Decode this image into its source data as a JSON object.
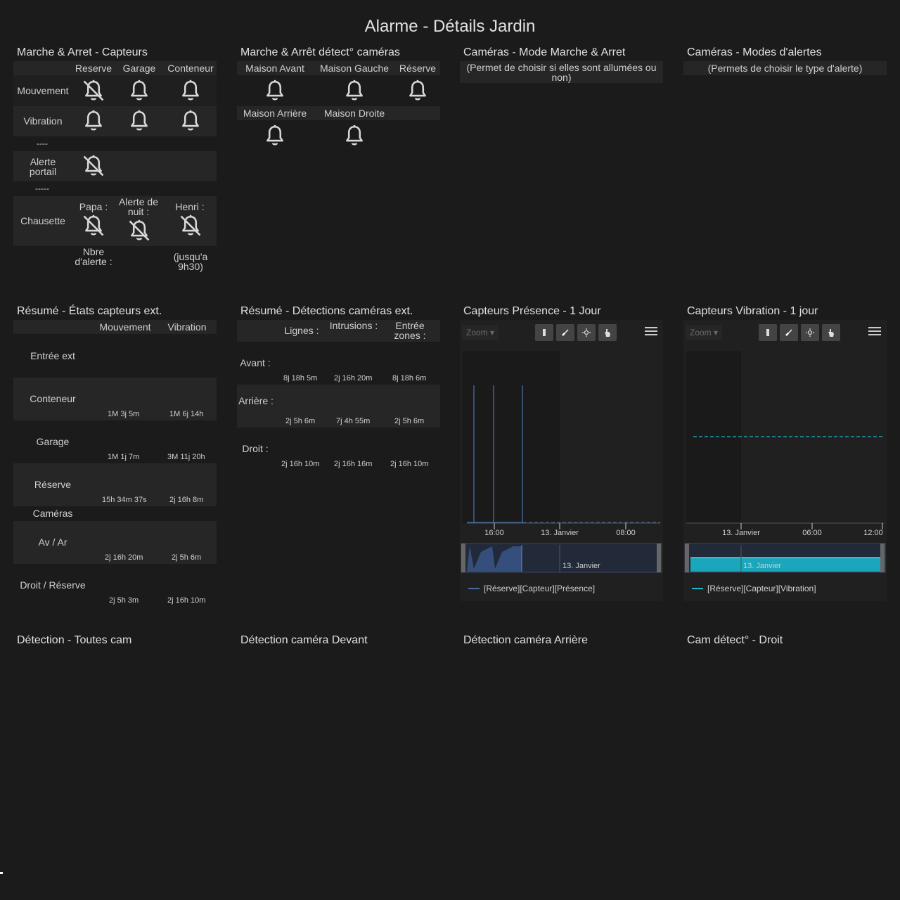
{
  "page_title": "Alarme - Détails Jardin",
  "icons": [
    "bell-icon",
    "bell-off-icon",
    "reset-zoom-icon",
    "zoom-out-icon",
    "refresh-icon",
    "pan-icon",
    "menu-icon"
  ],
  "sensors": {
    "title": "Marche & Arret - Capteurs",
    "headers": [
      "Reserve",
      "Garage",
      "Conteneur"
    ],
    "rows": {
      "motion": "Mouvement",
      "vibration": "Vibration",
      "sep1": "----",
      "gate": "Alerte portail",
      "sep2": "-----",
      "sock": "Chausette"
    },
    "sock_cols": [
      "Papa :",
      "Alerte de nuit :",
      "Henri :"
    ],
    "notes": [
      "Nbre d'alerte :",
      "(jusqu'a 9h30)"
    ]
  },
  "cam_detect": {
    "title": "Marche & Arrêt détect° caméras",
    "headers1": [
      "Maison Avant",
      "Maison Gauche",
      "Réserve"
    ],
    "headers2": [
      "Maison Arrière",
      "Maison Droite"
    ]
  },
  "cam_mode": {
    "title": "Caméras - Mode Marche & Arret",
    "subtitle": "(Permet de choisir si elles sont allumées ou non)"
  },
  "cam_alert": {
    "title": "Caméras - Modes d'alertes",
    "subtitle": "(Permets de choisir le type d'alerte)"
  },
  "sensor_summary": {
    "title": "Résumé - États capteurs ext.",
    "headers": [
      "Mouvement",
      "Vibration"
    ],
    "rows": [
      {
        "label": "Entrée ext",
        "motion": "",
        "vibration": ""
      },
      {
        "label": "Conteneur",
        "motion": "1M 3j 5m",
        "vibration": "1M 6j 14h"
      },
      {
        "label": "Garage",
        "motion": "1M 1j 7m",
        "vibration": "3M 11j 20h"
      },
      {
        "label": "Réserve",
        "motion": "15h 34m 37s",
        "vibration": "2j 16h 8m"
      },
      {
        "label": "Caméras",
        "motion": "",
        "vibration": ""
      },
      {
        "label": "Av / Ar",
        "motion": "2j 16h 20m",
        "vibration": "2j 5h 6m"
      },
      {
        "label": "Droit / Réserve",
        "motion": "2j 5h 3m",
        "vibration": "2j 16h 10m"
      }
    ]
  },
  "cam_summary": {
    "title": "Résumé - Détections caméras ext.",
    "headers": [
      "Lignes :",
      "Intrusions :",
      "Entrée zones :"
    ],
    "rows": [
      {
        "label": "Avant :",
        "values": [
          "8j 18h 5m",
          "2j 16h 20m",
          "8j 18h 6m"
        ]
      },
      {
        "label": "Arrière :",
        "values": [
          "2j 5h 6m",
          "7j 4h 55m",
          "2j 5h 6m"
        ]
      },
      {
        "label": "Droit :",
        "values": [
          "2j 16h 10m",
          "2j 16h 16m",
          "2j 16h 10m"
        ]
      }
    ]
  },
  "presence_chart": {
    "title": "Capteurs Présence - 1 Jour",
    "zoom": "Zoom ▾",
    "xticks": [
      "16:00",
      "13. Janvier",
      "08:00"
    ],
    "navigator_label": "13. Janvier",
    "legend": "[Réserve][Capteur][Présence]",
    "color": "#4a6da0"
  },
  "vibration_chart": {
    "title": "Capteurs Vibration - 1 jour",
    "zoom": "Zoom ▾",
    "xticks": [
      "13. Janvier",
      "06:00",
      "12:00"
    ],
    "navigator_label": "13. Janvier",
    "legend": "[Réserve][Capteur][Vibration]",
    "color": "#1eb4c8"
  },
  "bottom_titles": [
    "Détection - Toutes cam",
    "Détection caméra Devant",
    "Détection caméra Arrière",
    "Cam détect° - Droit"
  ]
}
